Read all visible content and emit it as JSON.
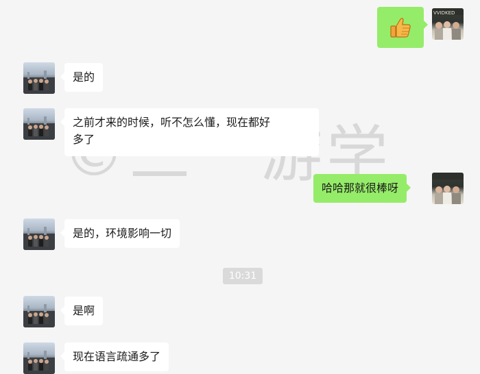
{
  "watermark": "©三一游学",
  "time_divider": "10:31",
  "messages": [
    {
      "side": "right",
      "type": "emoji",
      "emoji_name": "thumbs-up-icon"
    },
    {
      "side": "left",
      "text": "是的"
    },
    {
      "side": "left",
      "text_line1": "之前才来的时候，听不怎么懂，现在都好",
      "text_line2": "多了"
    },
    {
      "side": "right",
      "text": "哈哈那就很棒呀"
    },
    {
      "side": "left",
      "text": "是的，环境影响一切"
    },
    {
      "side": "left",
      "text": "是啊"
    },
    {
      "side": "left",
      "text": "现在语言疏通多了"
    }
  ],
  "avatar_me_text": "VVIDKED",
  "colors": {
    "background": "#f5f5f5",
    "bubble_left": "#ffffff",
    "bubble_right": "#95ec69",
    "time_badge": "#dadada"
  }
}
